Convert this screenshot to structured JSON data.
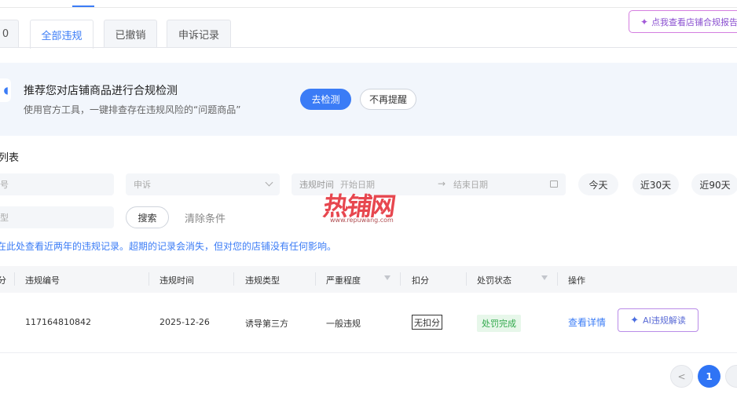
{
  "tabs": [
    {
      "label": "0"
    },
    {
      "label": "全部违规"
    },
    {
      "label": "已撤销"
    },
    {
      "label": "申诉记录"
    }
  ],
  "report_button": {
    "label": "点我查看店铺合规报告"
  },
  "banner": {
    "title": "推荐您对店铺商品进行合规检测",
    "subtitle": "使用官方工具，一键排查存在违规风险的“问题商品”",
    "primary_button": "去检测",
    "secondary_button": "不再提醒"
  },
  "section_title": "列表",
  "filters": {
    "field1_placeholder": "号",
    "appeal_placeholder": "申诉",
    "time_label": "违规时间",
    "start_placeholder": "开始日期",
    "end_placeholder": "结束日期",
    "field4_placeholder": "型",
    "quick": [
      "今天",
      "近30天",
      "近90天"
    ],
    "search_button": "搜索",
    "clear_link": "清除条件"
  },
  "watermark": {
    "text": "热铺网",
    "url": "www.repuwang.com"
  },
  "notice": "在此处查看近两年的违规记录。超期的记录会消失，但对您的店铺没有任何影响。",
  "table": {
    "headers": [
      "分",
      "违规编号",
      "违规时间",
      "违规类型",
      "严重程度",
      "扣分",
      "处罚状态",
      "操作"
    ],
    "rows": [
      {
        "id": "117164810842",
        "time": "2025-12-26",
        "type": "诱导第三方",
        "severity": "一般违规",
        "points": "无扣分",
        "status": "处罚完成",
        "detail_link": "查看详情",
        "ai_button": "AI违规解读"
      }
    ]
  },
  "pagination": {
    "prev": "<",
    "current": "1"
  }
}
